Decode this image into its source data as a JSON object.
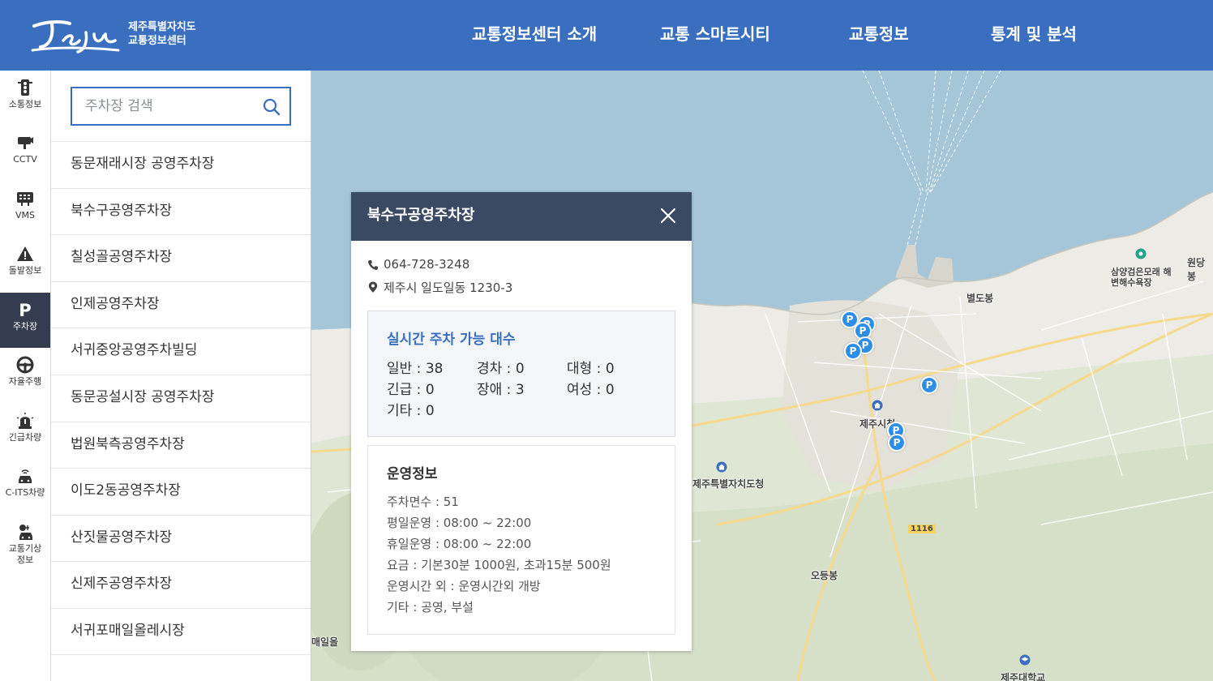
{
  "header": {
    "logo_text": "Jeju",
    "org_line1": "제주특별자치도",
    "org_line2": "교통정보센터",
    "nav": [
      "교통정보센터 소개",
      "교통 스마트시티",
      "교통정보",
      "통계 및 분석"
    ]
  },
  "leftnav": {
    "items": [
      {
        "label": "소통정보",
        "icon": "traffic-light-icon"
      },
      {
        "label": "CCTV",
        "icon": "cctv-icon"
      },
      {
        "label": "VMS",
        "icon": "vms-board-icon"
      },
      {
        "label": "돌발정보",
        "icon": "warning-icon"
      },
      {
        "label": "주차장",
        "icon": "parking-icon"
      },
      {
        "label": "자율주행",
        "icon": "steering-wheel-icon"
      },
      {
        "label": "긴급차량",
        "icon": "emergency-siren-icon"
      },
      {
        "label": "C-ITS차량",
        "icon": "connected-car-icon"
      },
      {
        "label": "교통기상 정보",
        "icon": "weather-car-icon"
      }
    ],
    "active": "주차장"
  },
  "search": {
    "placeholder": "주차장 검색",
    "value": ""
  },
  "parking_list": [
    "동문재래시장 공영주차장",
    "북수구공영주차장",
    "칠성골공영주차장",
    "인제공영주차장",
    "서귀중앙공영주차빌딩",
    "동문공설시장 공영주차장",
    "법원북측공영주차장",
    "이도2동공영주차장",
    "산짓물공영주차장",
    "신제주공영주차장",
    "서귀포매일올레시장"
  ],
  "popup": {
    "title": "북수구공영주차장",
    "phone": "064-728-3248",
    "address": "제주시 일도일동 1230-3",
    "realtime_title": "실시간 주차 가능 대수",
    "realtime": [
      {
        "label": "일반",
        "value": "38"
      },
      {
        "label": "경차",
        "value": "0"
      },
      {
        "label": "대형",
        "value": "0"
      },
      {
        "label": "긴급",
        "value": "0"
      },
      {
        "label": "장애",
        "value": "3"
      },
      {
        "label": "여성",
        "value": "0"
      },
      {
        "label": "기타",
        "value": "0"
      }
    ],
    "operation_title": "운영정보",
    "operation": [
      "주차면수 : 51",
      "평일운영 : 08:00 ~ 22:00",
      "휴일운영 : 08:00 ~ 22:00",
      "요금 : 기본30분 1000원, 초과15분 500원",
      "운영시간 외 : 운영시간외 개방",
      "기타 : 공영, 부설"
    ]
  },
  "map": {
    "labels": [
      "별도봉",
      "삼양검은모래 해변해수욕장",
      "원당봉",
      "제주시청",
      "제주특별자치도청",
      "오등봉",
      "제주대학교",
      "1116",
      "매일올"
    ],
    "pin_label": "P"
  },
  "colors": {
    "header": "#3a6fc0",
    "popup_header": "#3b4a63",
    "pin": "#2d8ee8",
    "sea": "#a4c6d8"
  }
}
